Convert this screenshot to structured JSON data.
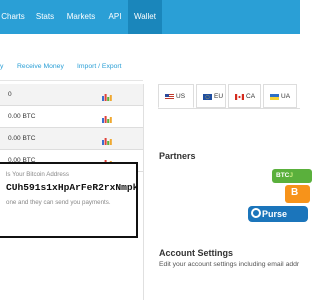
{
  "nav": {
    "items": [
      "Charts",
      "Stats",
      "Markets",
      "API",
      "Wallet"
    ],
    "active": "Wallet"
  },
  "subnav": {
    "items": [
      "y",
      "Receive Money",
      "Import / Export"
    ]
  },
  "balances": [
    {
      "amount": "0"
    },
    {
      "amount": "0.00 BTC"
    },
    {
      "amount": "0.00 BTC"
    },
    {
      "amount": "0.00 BTC"
    }
  ],
  "address_box": {
    "label": "ls Your Bitcoin Address",
    "address": "CUh591s1xHpArFeR2rxNmpk",
    "note": "one and they can send you payments."
  },
  "currency_tabs": [
    {
      "code": "US",
      "icon": "flag-us-icon"
    },
    {
      "code": "EU",
      "icon": "flag-eu-icon"
    },
    {
      "code": "CA",
      "icon": "flag-ca-icon"
    },
    {
      "code": "UA",
      "icon": "flag-ua-icon"
    }
  ],
  "partners": {
    "title": "Partners",
    "logo_btc": "BTC",
    "logo_btc_suffix": "J",
    "logo_b": "B",
    "logo_purse": "Purse"
  },
  "account_settings": {
    "title": "Account Settings",
    "subtitle": "Edit your account settings including email addr"
  },
  "colors": {
    "nav_bg": "#2a9fd6",
    "nav_active": "#1a86bb",
    "link": "#2a9fd6"
  }
}
